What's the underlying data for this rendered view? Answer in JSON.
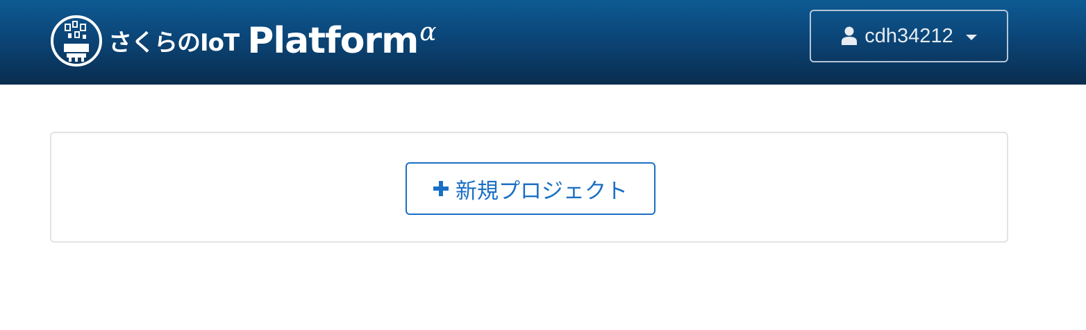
{
  "header": {
    "brand_ja": "さくらのIoT",
    "brand_en": "Platform",
    "brand_alpha": "α",
    "logo_icon": "sakura-iot-logo-icon",
    "user": {
      "name": "cdh34212",
      "icon": "user-icon",
      "caret_icon": "caret-down-icon"
    }
  },
  "main": {
    "new_project_label": "新規プロジェクト",
    "new_project_icon": "plus-icon"
  },
  "colors": {
    "navbar_top": "#0d5a93",
    "navbar_bottom": "#0a2d4f",
    "primary": "#1a6fc4",
    "panel_border": "#e1e3e6"
  }
}
